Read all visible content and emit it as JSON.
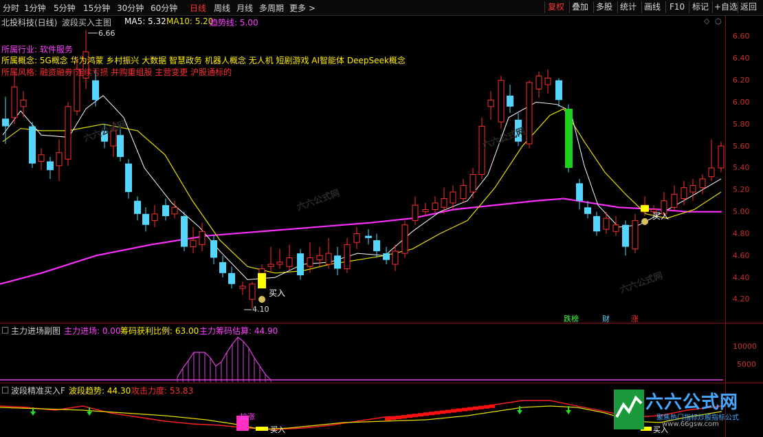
{
  "toolbar": {
    "periods": [
      "分时",
      "1分钟",
      "5分钟",
      "15分钟",
      "30分钟",
      "60分钟",
      "日线",
      "周线",
      "月线",
      "多周期",
      "更多 >"
    ],
    "active_period": "日线",
    "right_buttons": [
      "复权",
      "叠加",
      "多股",
      "统计",
      "画线",
      "F10",
      "标记",
      "+自选",
      "返回"
    ],
    "highlight": "复权"
  },
  "main_panel": {
    "stock_name": "北投科技(日线)",
    "indicator_name": "波段买入主图",
    "ma5_label": "MA5: 5.32",
    "ma10_label": "MA10: 5.20",
    "trend_label": "趋势线: 5.00",
    "high_marker": "6.66",
    "low_marker": "4.10",
    "industry": "所属行业: 软件服务",
    "concept": "所属概念: 5G概念 华为鸿蒙 乡村振兴 大数据 智慧政务 机器人概念 无人机 短剧游戏 AI智能体 DeepSeek概念",
    "style": "所属风格: 融资融券 连续亏损 并购重组股 主营变更 沪股通标的",
    "buy_label_1": "买入",
    "buy_label_2": "买入",
    "badges": [
      "跌榜",
      "财",
      "涨"
    ],
    "y_ticks": [
      "6.60",
      "6.40",
      "6.20",
      "6.00",
      "5.80",
      "5.60",
      "5.40",
      "5.20",
      "5.00",
      "4.80",
      "4.60",
      "4.40",
      "4.20"
    ],
    "watermark": "六六公式网"
  },
  "sub_panel_1": {
    "name": "主力进场副图",
    "main_in": "主力进场: 0.00",
    "profit_ratio": "筹码获利比例: 63.00",
    "main_chip": "主力筹码估算: 44.90",
    "y_ticks": [
      "10000",
      "5000"
    ]
  },
  "sub_panel_2": {
    "name": "波段精准买入F",
    "trend": "波段趋势: 44.30",
    "attack": "攻击力度: 53.83",
    "label_top": "拉涨",
    "buy_label_1": "买入",
    "buy_label_2": "买入"
  },
  "logo": {
    "name": "六六公式网",
    "slogan": "聚焦热门指标炒股指标公式",
    "url": "www.66gsw.com"
  },
  "colors": {
    "up": "#ff3030",
    "down": "#54d6ff",
    "ma5": "#ffffff",
    "ma10": "#e8e000",
    "trend": "#ff30ff",
    "buy_box": "#ffff00"
  }
}
